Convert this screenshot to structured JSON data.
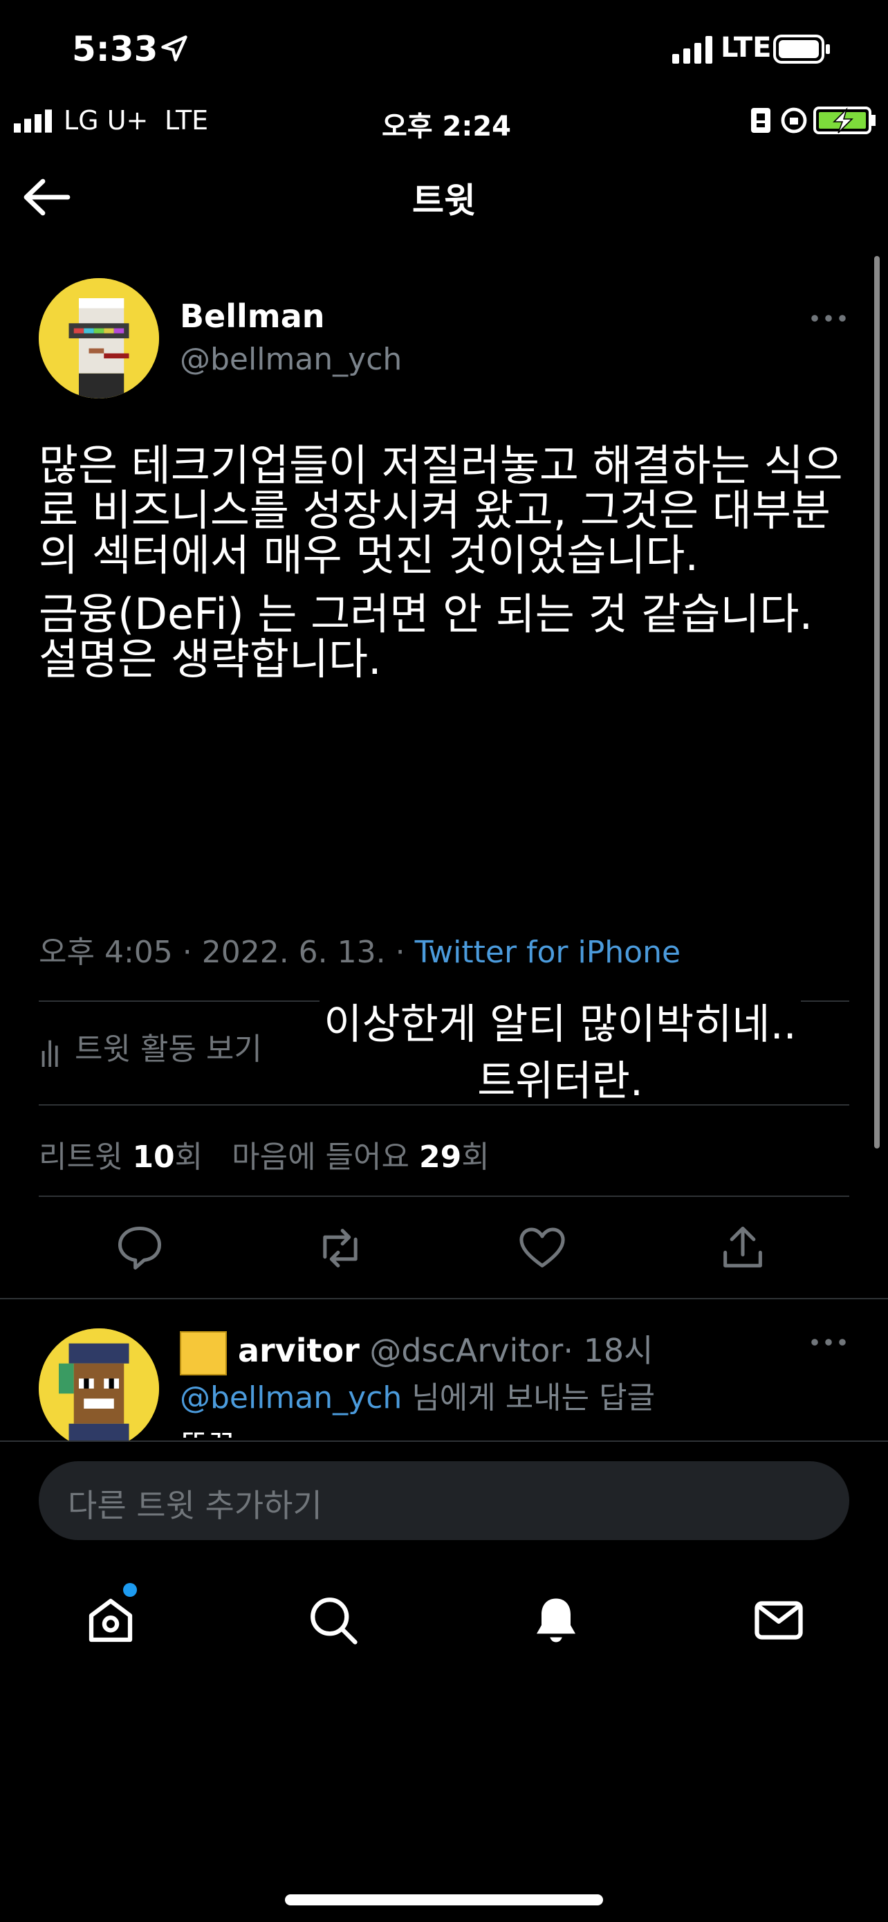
{
  "ios_status": {
    "time": "5:33",
    "network": "LTE"
  },
  "android_status": {
    "carrier": "LG U+",
    "network": "LTE",
    "time": "오후 2:24"
  },
  "header": {
    "title": "트윗"
  },
  "tweet": {
    "author_name": "Bellman",
    "author_handle": "@bellman_ych",
    "paragraph_1": "많은 테크기업들이 저질러놓고 해결하는 식으로 비즈니스를 성장시켜 왔고, 그것은 대부분의 섹터에서 매우 멋진 것이었습니다.",
    "paragraph_2": "금융(DeFi) 는 그러면 안 되는 것 같습니다. 설명은 생략합니다.",
    "time": "오후 4:05 · 2022. 6. 13. · ",
    "source": "Twitter for iPhone",
    "activity_label": "트윗 활동 보기",
    "retweet_label": "리트윗 ",
    "retweet_count": "10",
    "retweet_unit": "회",
    "like_label": "마음에 들어요 ",
    "like_count": "29",
    "like_unit": "회"
  },
  "overlay_caption": {
    "line_1": "이상한게 알티 많이박히네..",
    "line_2": "트위터란."
  },
  "reply": {
    "author_name": "arvitor",
    "author_handle": "@dscArvitor",
    "time": "· 18시",
    "replying_mention": "@bellman_ych",
    "replying_suffix": " 님에게 보내는 답글",
    "text": "또끄"
  },
  "compose": {
    "placeholder": "다른 트윗 추가하기"
  },
  "icons": {
    "actions": [
      "reply-icon",
      "retweet-icon",
      "like-icon",
      "share-icon"
    ],
    "nav": [
      "home-icon",
      "search-icon",
      "notifications-icon",
      "messages-icon"
    ]
  },
  "colors": {
    "link": "#4b9bdc",
    "notification_dot": "#1d9bf0",
    "battery_charging": "#7ddc3b"
  }
}
